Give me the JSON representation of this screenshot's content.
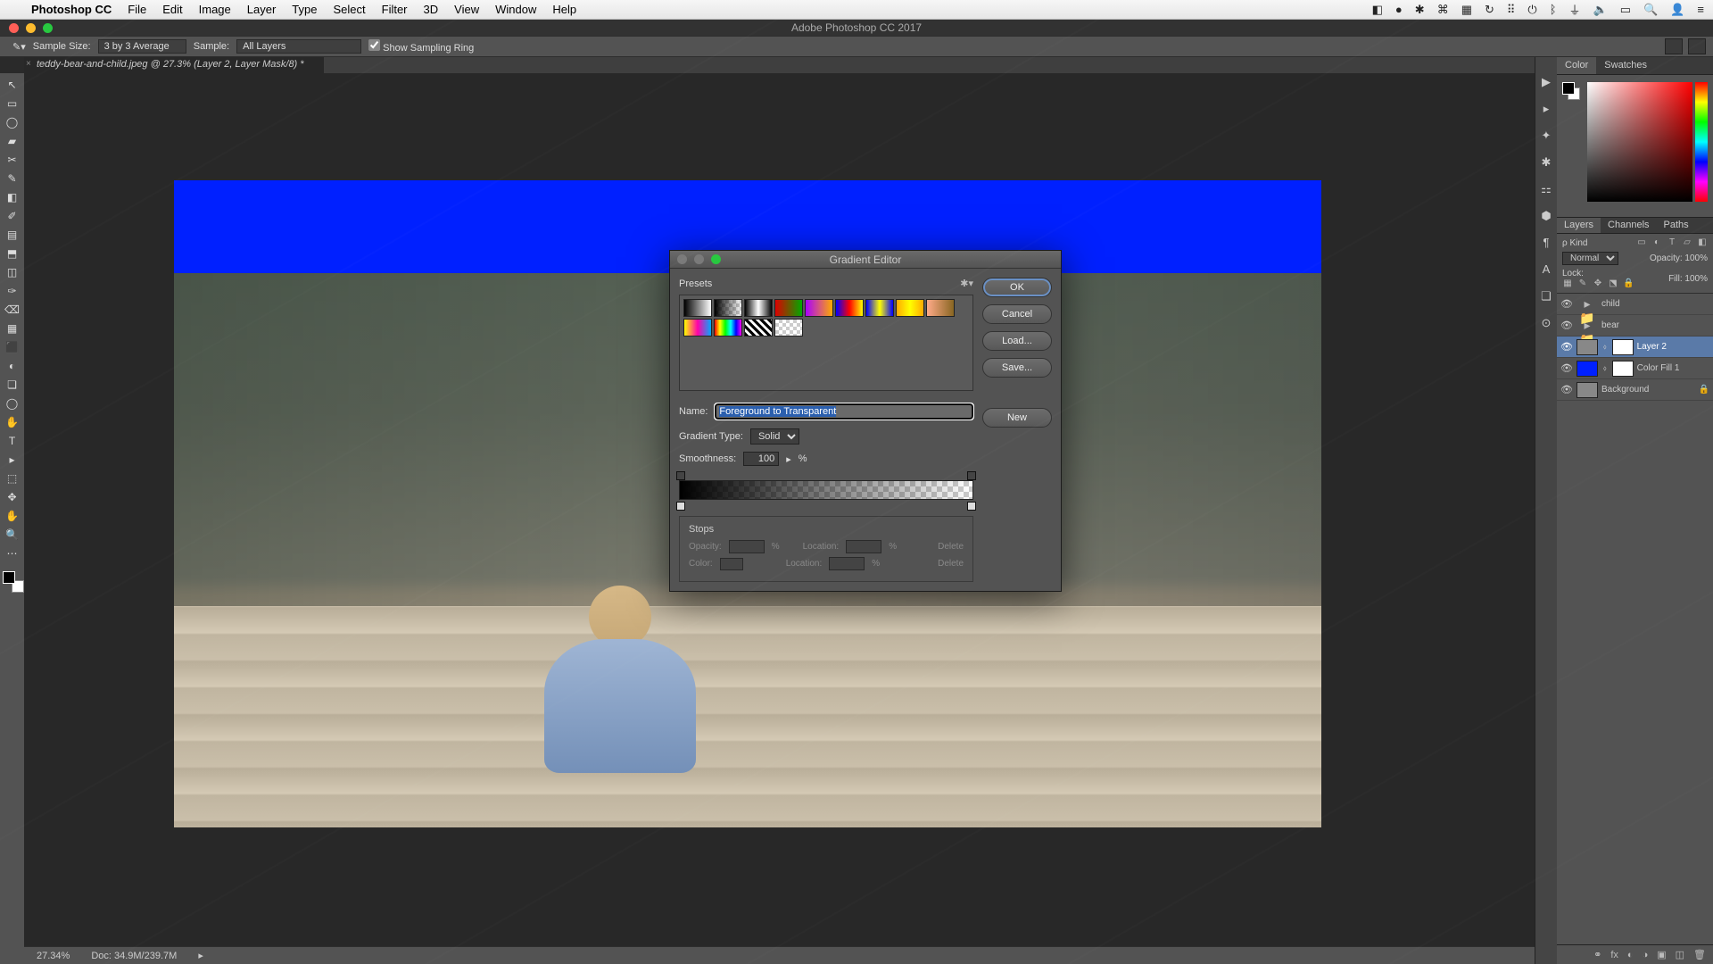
{
  "mac_menu": {
    "app": "Photoshop CC",
    "items": [
      "File",
      "Edit",
      "Image",
      "Layer",
      "Type",
      "Select",
      "Filter",
      "3D",
      "View",
      "Window",
      "Help"
    ]
  },
  "app_title": "Adobe Photoshop CC 2017",
  "options_bar": {
    "sample_size_label": "Sample Size:",
    "sample_size_value": "3 by 3 Average",
    "sample_label": "Sample:",
    "sample_value": "All Layers",
    "show_sampling_ring": "Show Sampling Ring"
  },
  "doc_tab": "teddy-bear-and-child.jpeg @ 27.3% (Layer 2, Layer Mask/8) *",
  "tools": [
    "↖",
    "▭",
    "◯",
    "▰",
    "✂",
    "✎",
    "◧",
    "✐",
    "▤",
    "⬒",
    "◫",
    "✑",
    "⌫",
    "▦",
    "⬛",
    "◐",
    "❏",
    "◯",
    "✋",
    "T",
    "▸",
    "⬚",
    "✥",
    "✋",
    "🔍",
    "⋯"
  ],
  "right_strip": [
    "▶",
    "▸",
    "✦",
    "✱",
    "⚏",
    "⬢",
    "¶",
    "A",
    "❏",
    "⊙"
  ],
  "color_tabs": {
    "color": "Color",
    "swatches": "Swatches"
  },
  "layers_tabs": {
    "layers": "Layers",
    "channels": "Channels",
    "paths": "Paths"
  },
  "layer_opts": {
    "kind": "Kind",
    "blend": "Normal",
    "opacity_label": "Opacity:",
    "opacity_value": "100%",
    "lock_label": "Lock:",
    "fill_label": "Fill:",
    "fill_value": "100%"
  },
  "layers": [
    {
      "name": "child",
      "type": "folder"
    },
    {
      "name": "bear",
      "type": "folder"
    },
    {
      "name": "Layer 2",
      "type": "layer",
      "selected": true,
      "thumb": "photo",
      "mask": "white",
      "link": true
    },
    {
      "name": "Color Fill 1",
      "type": "fill",
      "thumb": "blue",
      "mask": "white",
      "link": true
    },
    {
      "name": "Background",
      "type": "bg",
      "locked": true
    }
  ],
  "status": {
    "zoom": "27.34%",
    "doc": "Doc: 34.9M/239.7M"
  },
  "dialog": {
    "title": "Gradient Editor",
    "presets_label": "Presets",
    "name_label": "Name:",
    "name_value": "Foreground to Transparent",
    "type_label": "Gradient Type:",
    "type_value": "Solid",
    "smooth_label": "Smoothness:",
    "smooth_value": "100",
    "percent": "%",
    "stops_label": "Stops",
    "opacity_label": "Opacity:",
    "location_label": "Location:",
    "color_label": "Color:",
    "delete": "Delete",
    "buttons": {
      "ok": "OK",
      "cancel": "Cancel",
      "load": "Load...",
      "save": "Save...",
      "new": "New"
    },
    "preset_styles": [
      "linear-gradient(90deg,#000,#fff)",
      "linear-gradient(90deg,#000,transparent),repeating-conic-gradient(#ccc 0 25%,#fff 0 50%) 0 0/8px 8px",
      "linear-gradient(90deg,#000,#fff,#000)",
      "linear-gradient(90deg,#d00,#0a0)",
      "linear-gradient(90deg,#a0f,#fa0)",
      "linear-gradient(90deg,#00f,#f00,#ff0)",
      "linear-gradient(90deg,#00f,#ff0,#00f)",
      "linear-gradient(90deg,#fa0,#ff0,#fa0)",
      "linear-gradient(90deg,#fa8,#862)",
      "linear-gradient(90deg,#ff0,#f0a,#0af)",
      "linear-gradient(90deg,#f00,#ff0,#0f0,#0ff,#00f,#f0f)",
      "repeating-linear-gradient(45deg,#000 0 3px,#fff 3px 6px)",
      "repeating-conic-gradient(#ccc 0 25%,#fff 0 50%) 0 0/8px 8px"
    ]
  }
}
